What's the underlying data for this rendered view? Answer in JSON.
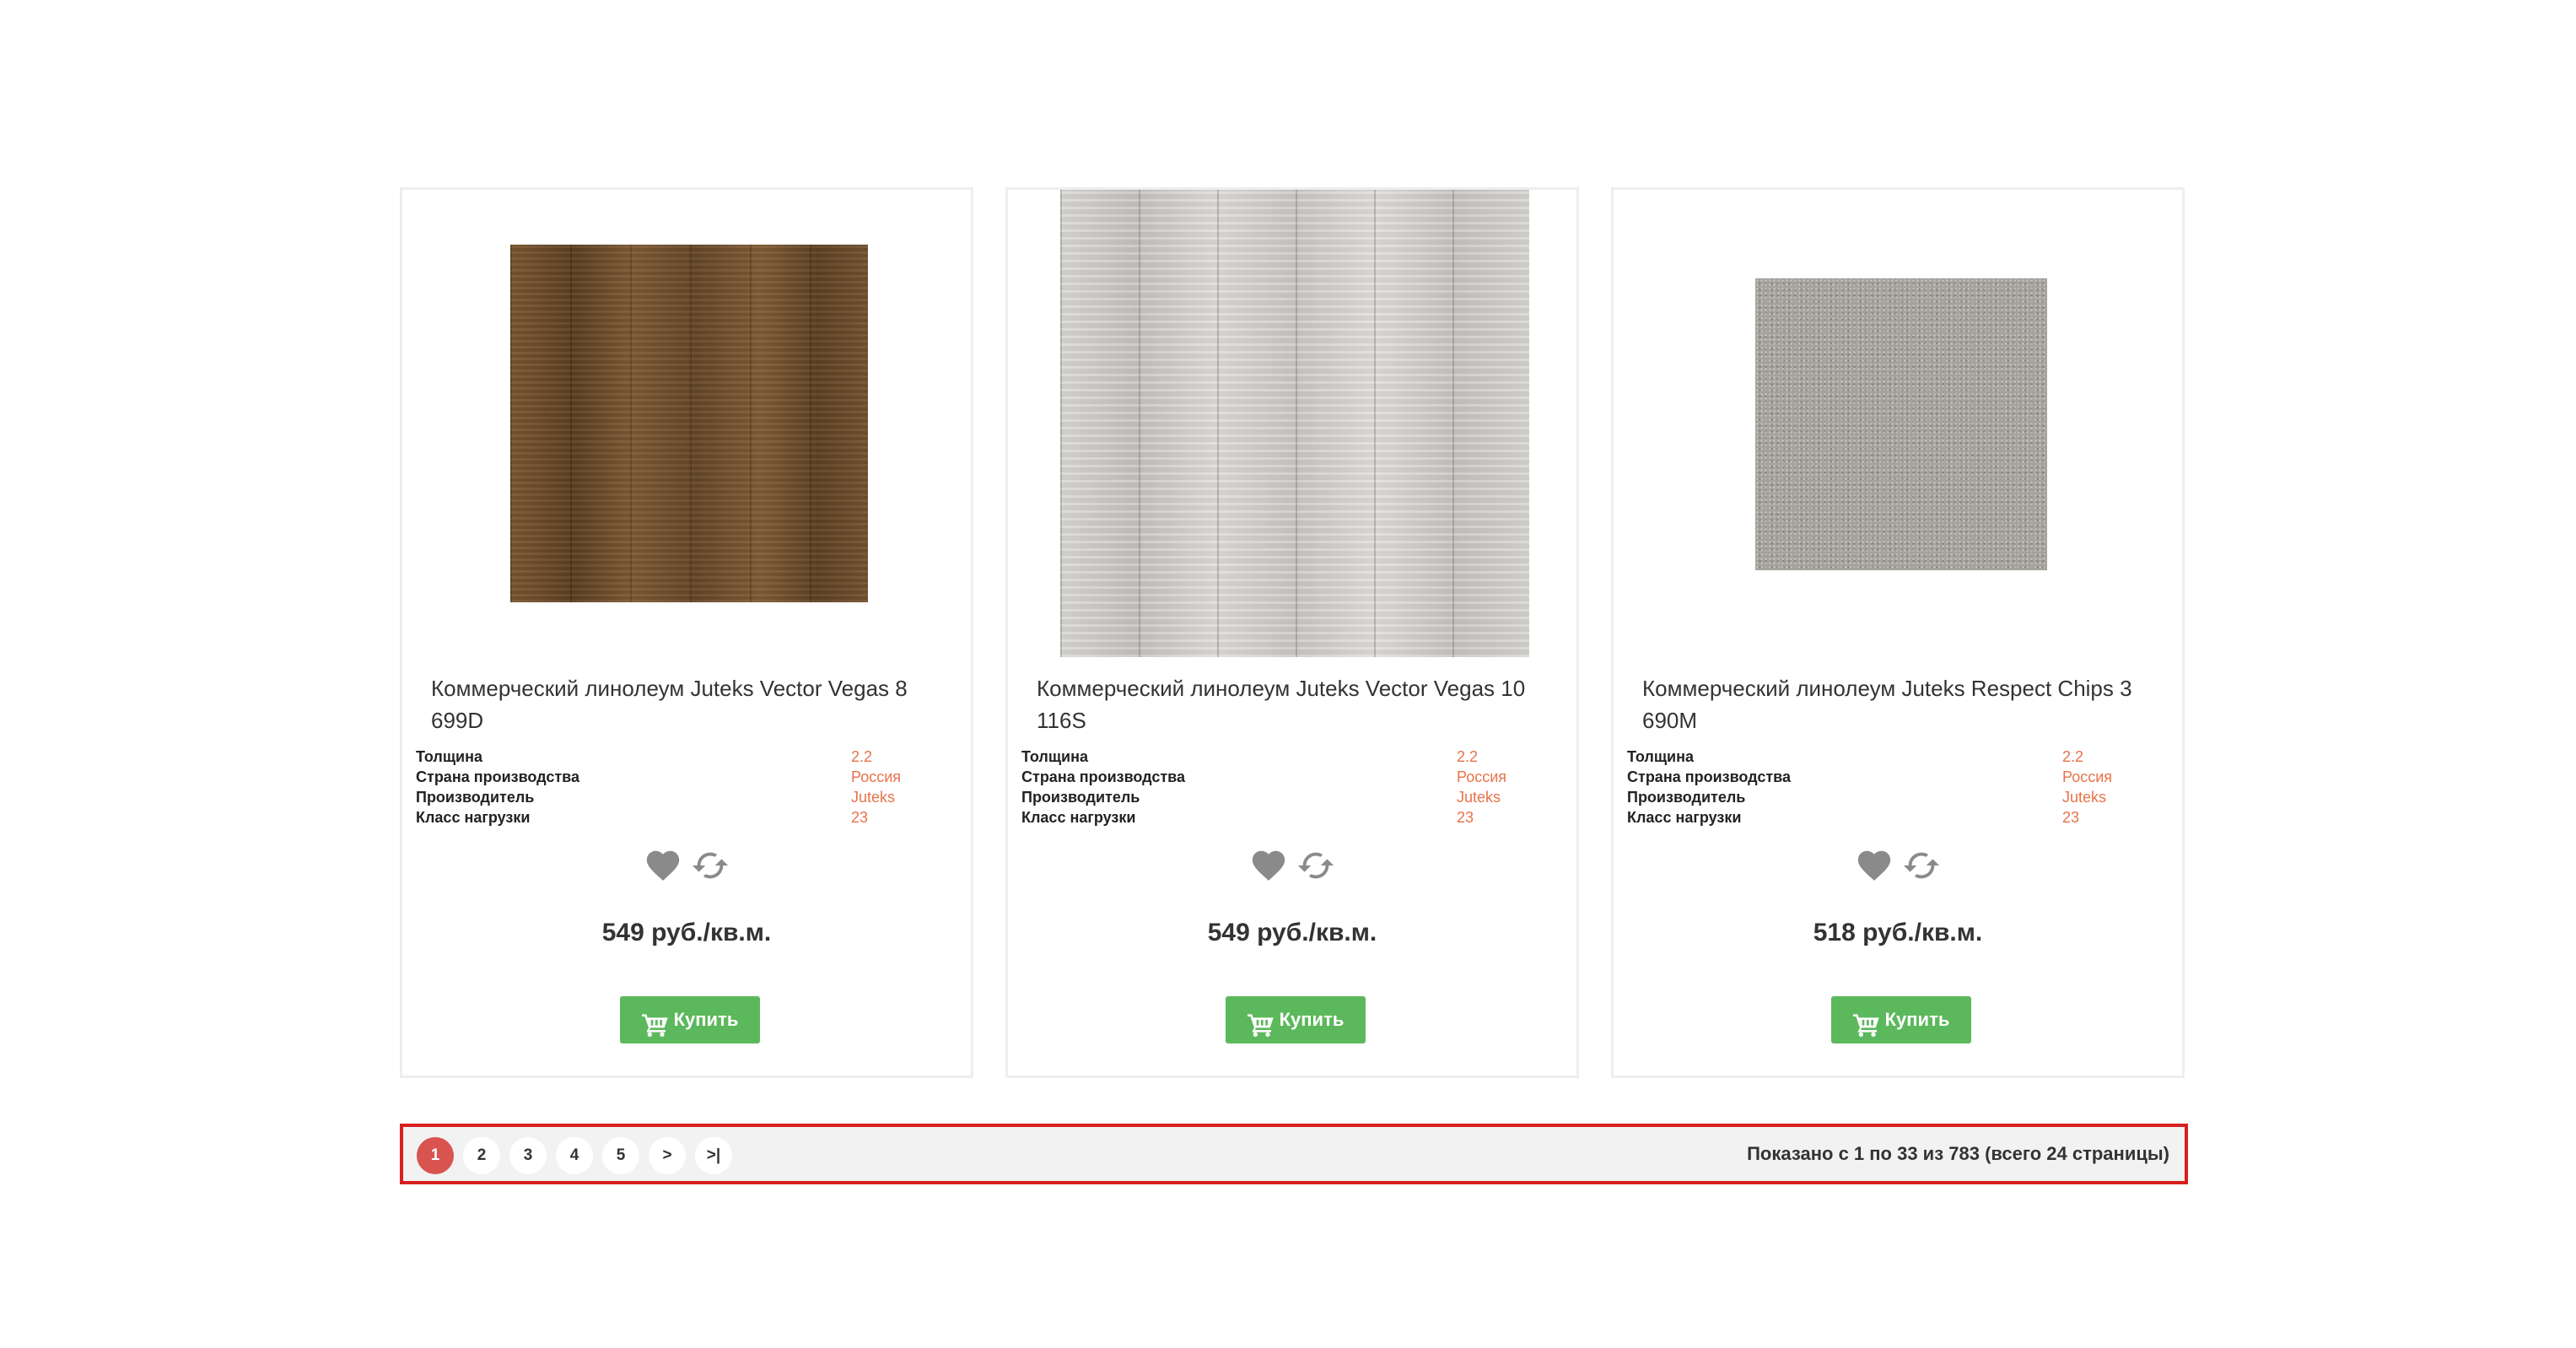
{
  "products": [
    {
      "title": "Коммерческий линолеум Juteks Vector Vegas 8 699D",
      "specs": [
        {
          "label": "Толщина",
          "value": "2.2"
        },
        {
          "label": "Страна производства",
          "value": "Россия"
        },
        {
          "label": "Производитель",
          "value": "Juteks"
        },
        {
          "label": "Класс нагрузки",
          "value": "23"
        }
      ],
      "price": "549 руб./кв.м.",
      "buy_label": "Купить"
    },
    {
      "title": "Коммерческий линолеум Juteks Vector Vegas 10 116S",
      "specs": [
        {
          "label": "Толщина",
          "value": "2.2"
        },
        {
          "label": "Страна производства",
          "value": "Россия"
        },
        {
          "label": "Производитель",
          "value": "Juteks"
        },
        {
          "label": "Класс нагрузки",
          "value": "23"
        }
      ],
      "price": "549 руб./кв.м.",
      "buy_label": "Купить"
    },
    {
      "title": "Коммерческий линолеум Juteks Respect Chips 3 690M",
      "specs": [
        {
          "label": "Толщина",
          "value": "2.2"
        },
        {
          "label": "Страна производства",
          "value": "Россия"
        },
        {
          "label": "Производитель",
          "value": "Juteks"
        },
        {
          "label": "Класс нагрузки",
          "value": "23"
        }
      ],
      "price": "518 руб./кв.м.",
      "buy_label": "Купить"
    }
  ],
  "icons": {
    "wishlist": "heart-icon",
    "compare": "refresh-icon",
    "cart": "cart-icon"
  },
  "colors": {
    "accent": "#e8734a",
    "buy_button": "#5cb85c",
    "active_page": "#d9534f",
    "highlight_border": "#d81e1e"
  },
  "pagination": {
    "pages": [
      "1",
      "2",
      "3",
      "4",
      "5",
      ">",
      ">|"
    ],
    "active_page": "1",
    "info": "Показано с 1 по 33 из 783 (всего 24 страницы)"
  }
}
